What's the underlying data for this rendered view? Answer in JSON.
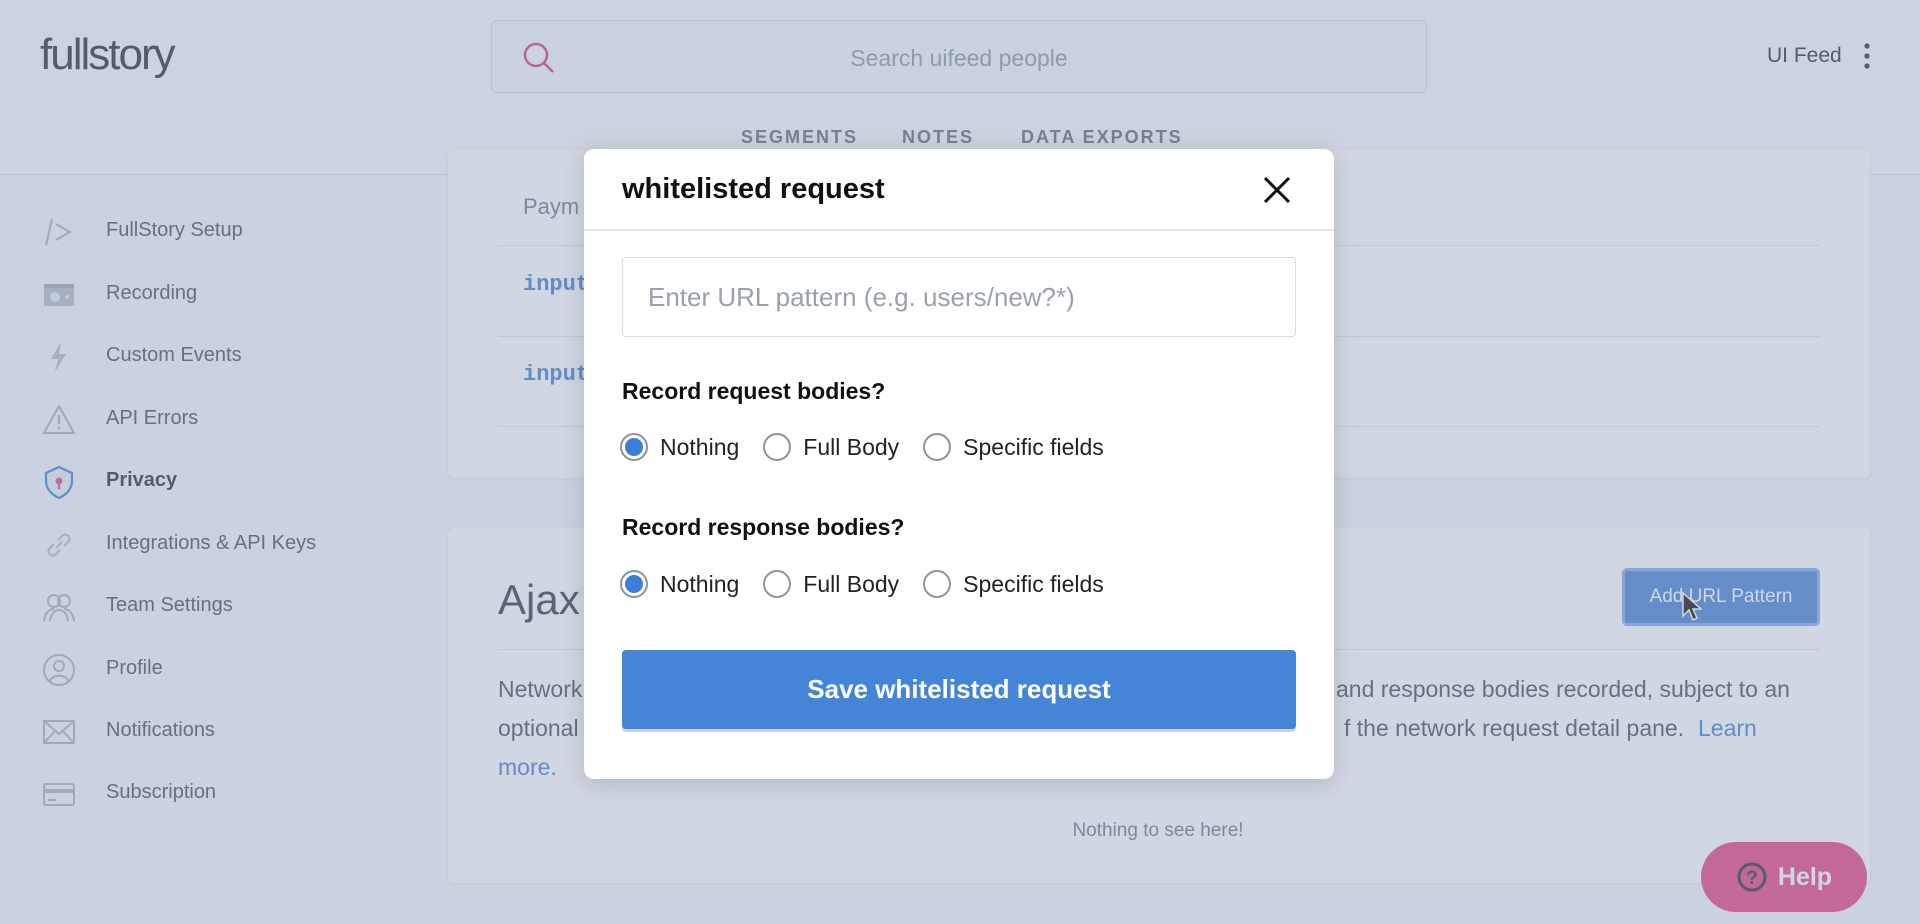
{
  "header": {
    "logo": "fullstory",
    "search_placeholder": "Search uifeed people",
    "tabs": [
      "SEGMENTS",
      "NOTES",
      "DATA EXPORTS"
    ],
    "org": "UI Feed"
  },
  "sidebar": {
    "items": [
      {
        "label": "FullStory Setup",
        "icon": "code-icon"
      },
      {
        "label": "Recording",
        "icon": "camera-icon"
      },
      {
        "label": "Custom Events",
        "icon": "lightning-icon"
      },
      {
        "label": "API Errors",
        "icon": "warning-icon"
      },
      {
        "label": "Privacy",
        "icon": "shield-lock-icon",
        "active": true
      },
      {
        "label": "Integrations & API Keys",
        "icon": "link-icon"
      },
      {
        "label": "Team Settings",
        "icon": "team-icon"
      },
      {
        "label": "Profile",
        "icon": "user-icon"
      },
      {
        "label": "Notifications",
        "icon": "envelope-icon"
      },
      {
        "label": "Subscription",
        "icon": "credit-card-icon"
      }
    ]
  },
  "top_card": {
    "rows": [
      "Paym",
      "input",
      "input"
    ]
  },
  "ajax_card": {
    "title": "Ajax",
    "add_button": "Add URL Pattern",
    "para_left": [
      "Network",
      "optional"
    ],
    "para_right": [
      "and response bodies recorded, subject to an",
      "f the network request detail pane."
    ],
    "learn": "Learn",
    "more": "more.",
    "empty": "Nothing to see here!"
  },
  "help": {
    "label": "Help"
  },
  "modal": {
    "title": "whitelisted request",
    "url_placeholder": "Enter URL pattern (e.g. users/new?*)",
    "url_value": "",
    "request_label": "Record request bodies?",
    "response_label": "Record response bodies?",
    "options": [
      "Nothing",
      "Full Body",
      "Specific fields"
    ],
    "request_selected": "Nothing",
    "response_selected": "Nothing",
    "save_label": "Save whitelisted request"
  },
  "colors": {
    "accent": "#4485d8",
    "help": "#e8397c",
    "privacy_icon": "#3b7bd4"
  }
}
